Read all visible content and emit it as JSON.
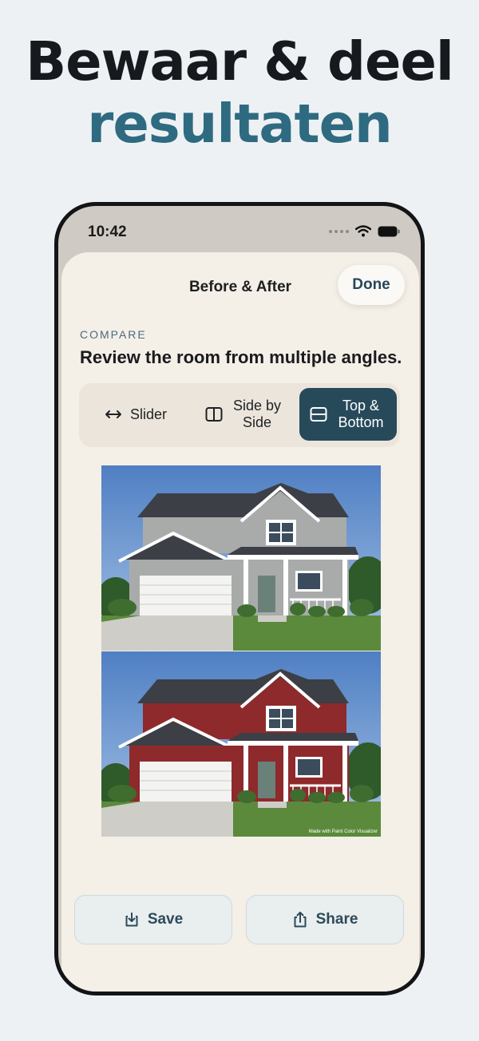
{
  "headline": {
    "line1": "Bewaar & deel",
    "line2": "resultaten"
  },
  "status_bar": {
    "time": "10:42",
    "icons": [
      "signal-dots-icon",
      "wifi-icon",
      "battery-icon"
    ]
  },
  "sheet": {
    "title": "Before & After",
    "done_label": "Done",
    "section_label": "COMPARE",
    "section_description": "Review the room from multiple angles.",
    "modes": [
      {
        "label": "Slider",
        "icon": "arrows-horizontal-icon",
        "selected": false
      },
      {
        "label": "Side by Side",
        "icon": "split-vertical-icon",
        "selected": false
      },
      {
        "label": "Top & Bottom",
        "icon": "split-horizontal-icon",
        "selected": true
      }
    ],
    "images": {
      "before": {
        "siding_color": "#a9abaa"
      },
      "after": {
        "siding_color": "#8e2a2b"
      },
      "watermark": "Made with Paint Color Visualizer"
    },
    "actions": {
      "save_label": "Save",
      "share_label": "Share"
    }
  },
  "colors": {
    "accent": "#274a5b",
    "headline_accent": "#2e6b80"
  }
}
